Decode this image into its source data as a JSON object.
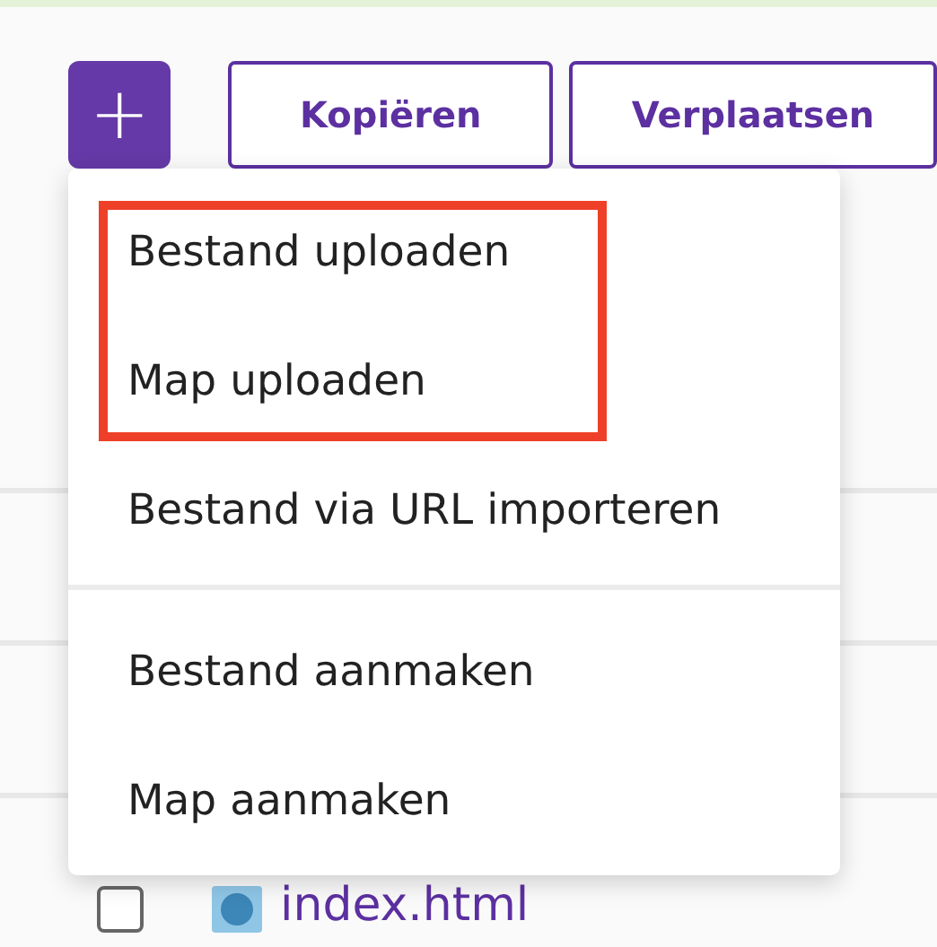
{
  "toolbar": {
    "add_button": {
      "label": "+"
    },
    "buttons": [
      "Kopiëren",
      "Verplaatsen"
    ]
  },
  "files": [
    {
      "name": "index.html",
      "checked": false
    }
  ],
  "menu": {
    "items": [
      {
        "label": "Bestand uploaden",
        "highlighted": true,
        "divider_after": false
      },
      {
        "label": "Map uploaden",
        "highlighted": true,
        "divider_after": false
      },
      {
        "label": "Bestand via URL importeren",
        "highlighted": false,
        "divider_after": true
      },
      {
        "label": "Bestand aanmaken",
        "highlighted": false,
        "divider_after": false
      },
      {
        "label": "Map aanmaken",
        "highlighted": false,
        "divider_after": false
      }
    ]
  }
}
